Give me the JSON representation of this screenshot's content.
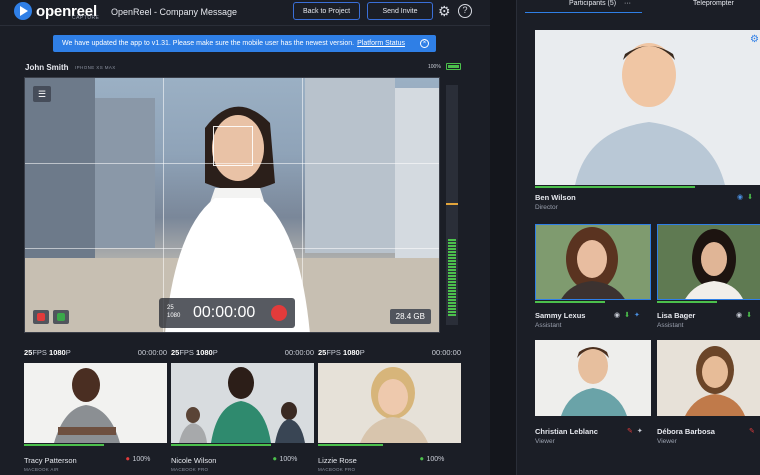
{
  "app": {
    "logo_text": "openreel",
    "logo_sub": "CAPTURE",
    "project_title": "OpenReel - Company Message",
    "back_button": "Back to Project",
    "invite_button": "Send Invite",
    "help_glyph": "?"
  },
  "banner": {
    "message": "We have updated the app to v1.31. Please make sure the mobile user has the newest version.",
    "link_text": "Platform Status",
    "close_glyph": "×"
  },
  "main_feed": {
    "name": "John Smith",
    "device": "IPHONE XS MAX",
    "battery": "100%",
    "resolution_line1": "25",
    "resolution_line2": "1080",
    "timer": "00:00:00",
    "storage": "28.4 GB",
    "level": 0.35
  },
  "thumbnails": [
    {
      "fps": "25",
      "fps_unit": "FPS",
      "res": "1080",
      "res_unit": "P",
      "timecode": "00:00:00",
      "name": "Tracy Patterson",
      "device": "MACBOOK AIR",
      "battery": "100%",
      "level": 0.55
    },
    {
      "fps": "25",
      "fps_unit": "FPS",
      "res": "1080",
      "res_unit": "P",
      "timecode": "00:00:00",
      "name": "Nicole Wilson",
      "device": "MACBOOK PRO",
      "battery": "100%",
      "level": 0.7
    },
    {
      "fps": "25",
      "fps_unit": "FPS",
      "res": "1080",
      "res_unit": "P",
      "timecode": "00:00:00",
      "name": "Lizzie Rose",
      "device": "MACBOOK PRO",
      "battery": "100%",
      "level": 0.45
    }
  ],
  "right_panel": {
    "tab_participants": "Participants (5)",
    "tab_more": "···",
    "tab_teleprompter": "Teleprompter",
    "participants": [
      {
        "name": "Ben Wilson",
        "role": "Director"
      },
      {
        "name": "Sammy Lexus",
        "role": "Assistant"
      },
      {
        "name": "Lisa Bager",
        "role": "Assistant"
      },
      {
        "name": "Christian Leblanc",
        "role": "Viewer"
      },
      {
        "name": "Débora Barbosa",
        "role": "Viewer"
      }
    ]
  },
  "colors": {
    "accent": "#2f7fe6",
    "record": "#e23b3b",
    "level_green": "#4cc04c",
    "bg": "#1b1e26"
  }
}
